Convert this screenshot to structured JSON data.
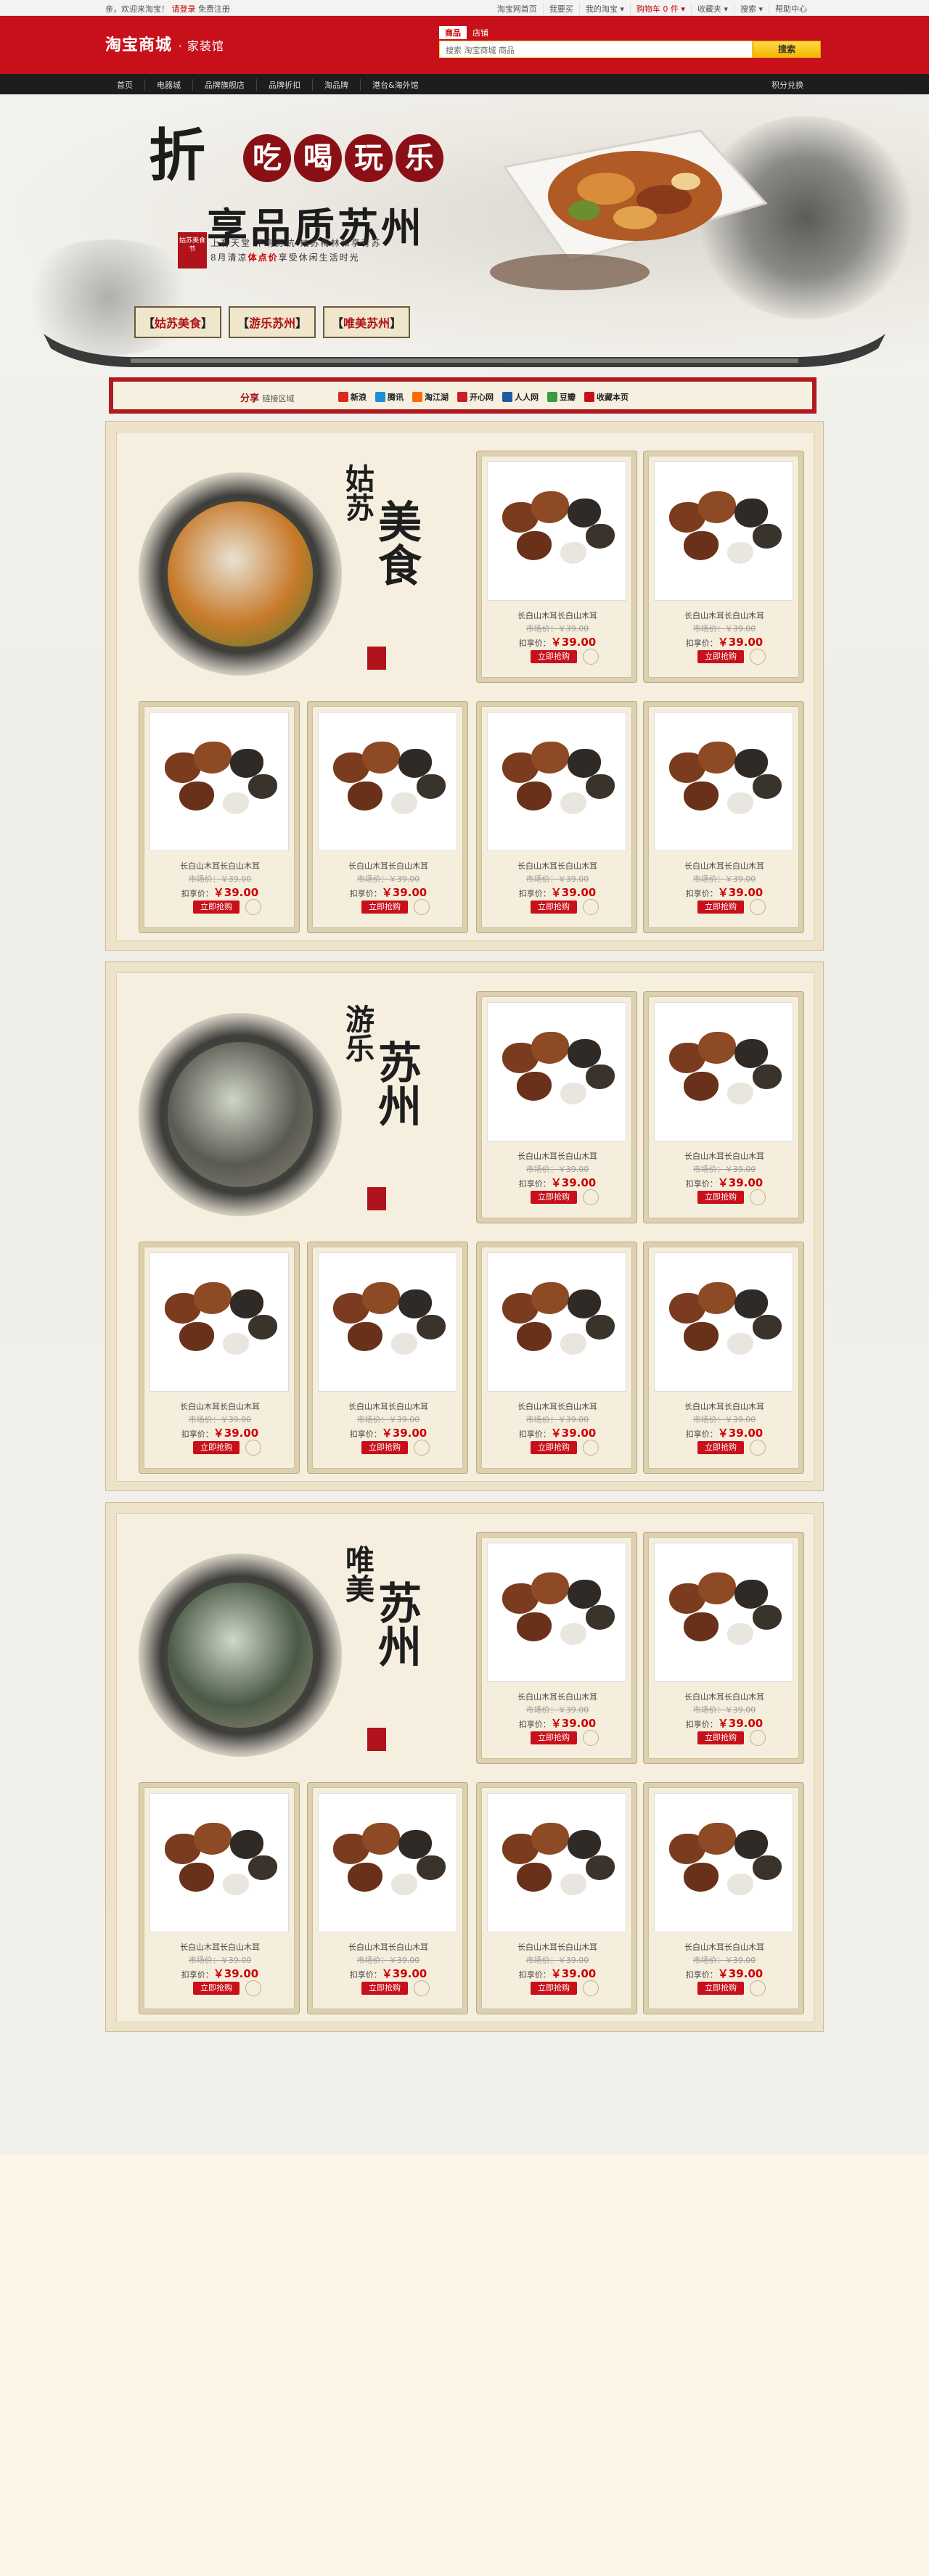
{
  "topbar": {
    "welcome_prefix": "亲，欢迎来淘宝！",
    "login": "请登录",
    "register": "免费注册",
    "links": [
      "淘宝网首页",
      "我要买",
      "我的淘宝 ▾",
      "购物车 0 件 ▾",
      "收藏夹 ▾",
      "搜索 ▾",
      "帮助中心"
    ]
  },
  "header": {
    "logo": "淘宝商城",
    "logo_sub": "· 家装馆",
    "search_tabs": [
      "商品",
      "店铺"
    ],
    "search_placeholder": "搜索 淘宝商城 商品",
    "search_button": "搜索"
  },
  "nav": {
    "items": [
      "首页",
      "电器城",
      "品牌旗舰店",
      "品牌折扣",
      "淘品牌",
      "港台&海外馆"
    ],
    "right": "积分兑换"
  },
  "hero": {
    "big_char": "折",
    "circle_chars": [
      "吃",
      "喝",
      "玩",
      "乐"
    ],
    "line2": "享品质苏州",
    "seal": "姑苏美食节",
    "sub_line1": "上有天堂 下有苏杭 姑苏梅林和享背苏",
    "sub_line2_a": "8月清凉",
    "sub_line2_red": "体点价",
    "sub_line2_b": "享受休闲生活时光",
    "labels": [
      "姑苏美食",
      "游乐苏州",
      "唯美苏州"
    ]
  },
  "share": {
    "title": "分享",
    "subtitle": "链接区域",
    "links": [
      {
        "label": "新浪",
        "color": "#e0271b"
      },
      {
        "label": "腾讯",
        "color": "#1c8fd8"
      },
      {
        "label": "淘江湖",
        "color": "#ff6a00"
      },
      {
        "label": "开心网",
        "color": "#c81f28"
      },
      {
        "label": "人人网",
        "color": "#1f5aa6"
      },
      {
        "label": "豆瓣",
        "color": "#3e9a3e"
      },
      {
        "label": "收藏本页",
        "color": "#c8101a"
      }
    ]
  },
  "sections": [
    {
      "title_c1": "姑苏",
      "title_c2": "美食"
    },
    {
      "title_c1": "游乐",
      "title_c2": "苏州"
    },
    {
      "title_c1": "唯美",
      "title_c2": "苏州"
    }
  ],
  "product": {
    "name": "长白山木耳长白山木耳",
    "orig_price": "市场价：￥39.00",
    "price_label": "扣享价：",
    "price": "￥39.00",
    "buy": "立即抢购"
  }
}
